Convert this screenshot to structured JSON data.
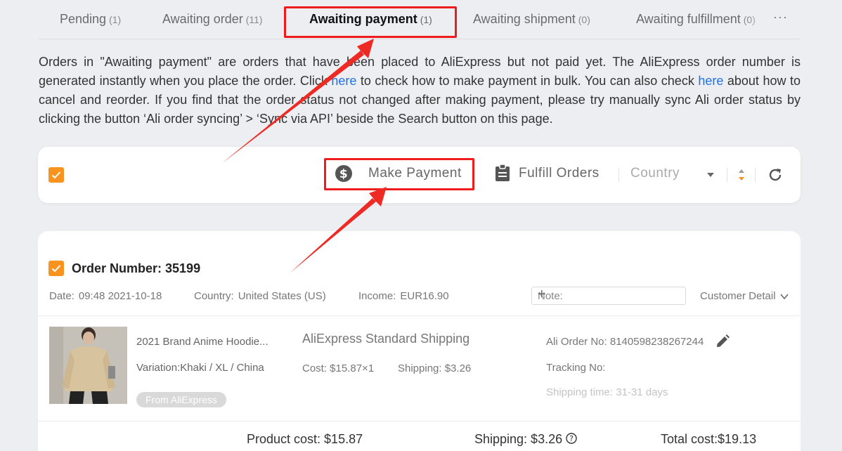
{
  "tabs": [
    {
      "label": "Pending",
      "count": "(1)"
    },
    {
      "label": "Awaiting order",
      "count": "(11)"
    },
    {
      "label": "Awaiting payment",
      "count": "(1)"
    },
    {
      "label": "Awaiting shipment",
      "count": "(0)"
    },
    {
      "label": "Awaiting fulfillment",
      "count": "(0)"
    }
  ],
  "tabs_more": "···",
  "info": {
    "part1": "Orders in \"Awaiting payment\" are orders that have been placed to AliExpress but not paid yet. The AliExpress order number is generated instantly when you place the order. Click ",
    "link1": "here",
    "part2": " to check how to make payment in bulk. You can also check ",
    "link2": "here",
    "part3": " about how to cancel and reorder. If you find that the order status not changed after making payment, please try manually sync Ali order status by clicking the button ‘Ali order syncing’ > ‘Sync via API’ beside the Search button on this page."
  },
  "toolbar": {
    "make_payment": "Make Payment",
    "fulfill_orders": "Fulfill Orders",
    "country": "Country"
  },
  "order": {
    "title": "Order Number: 35199",
    "date_label": "Date:",
    "date": "09:48 2021-10-18",
    "country_label": "Country:",
    "country": "United States (US)",
    "income_label": "Income:",
    "income": "EUR16.90",
    "note_placeholder": "Note:",
    "customer_detail": "Customer Detail",
    "product_name": "2021 Brand Anime Hoodie...",
    "variation": "Variation:Khaki / XL / China",
    "source_badge": "From AliExpress",
    "shipping_method": "AliExpress Standard Shipping",
    "cost": "Cost: $15.87×1",
    "shipping": "Shipping: $3.26",
    "ali_order_no": "Ali Order No: 8140598238267244",
    "tracking_no": "Tracking No:",
    "shipping_time": "Shipping time: 31-31 days",
    "product_cost_total": "Product cost: $15.87",
    "shipping_total": "Shipping: $3.26",
    "total_cost": "Total cost:$19.13"
  },
  "colors": {
    "accent_orange": "#f7931e",
    "highlight_red": "#ee1c1c",
    "link_blue": "#1c73e8",
    "background": "#edeef1"
  },
  "icons": [
    "dollar-circle-icon",
    "clipboard-icon",
    "chevron-down-icon",
    "sort-icon",
    "refresh-icon",
    "plus-icon",
    "pencil-icon",
    "help-circle-icon",
    "check-icon"
  ]
}
